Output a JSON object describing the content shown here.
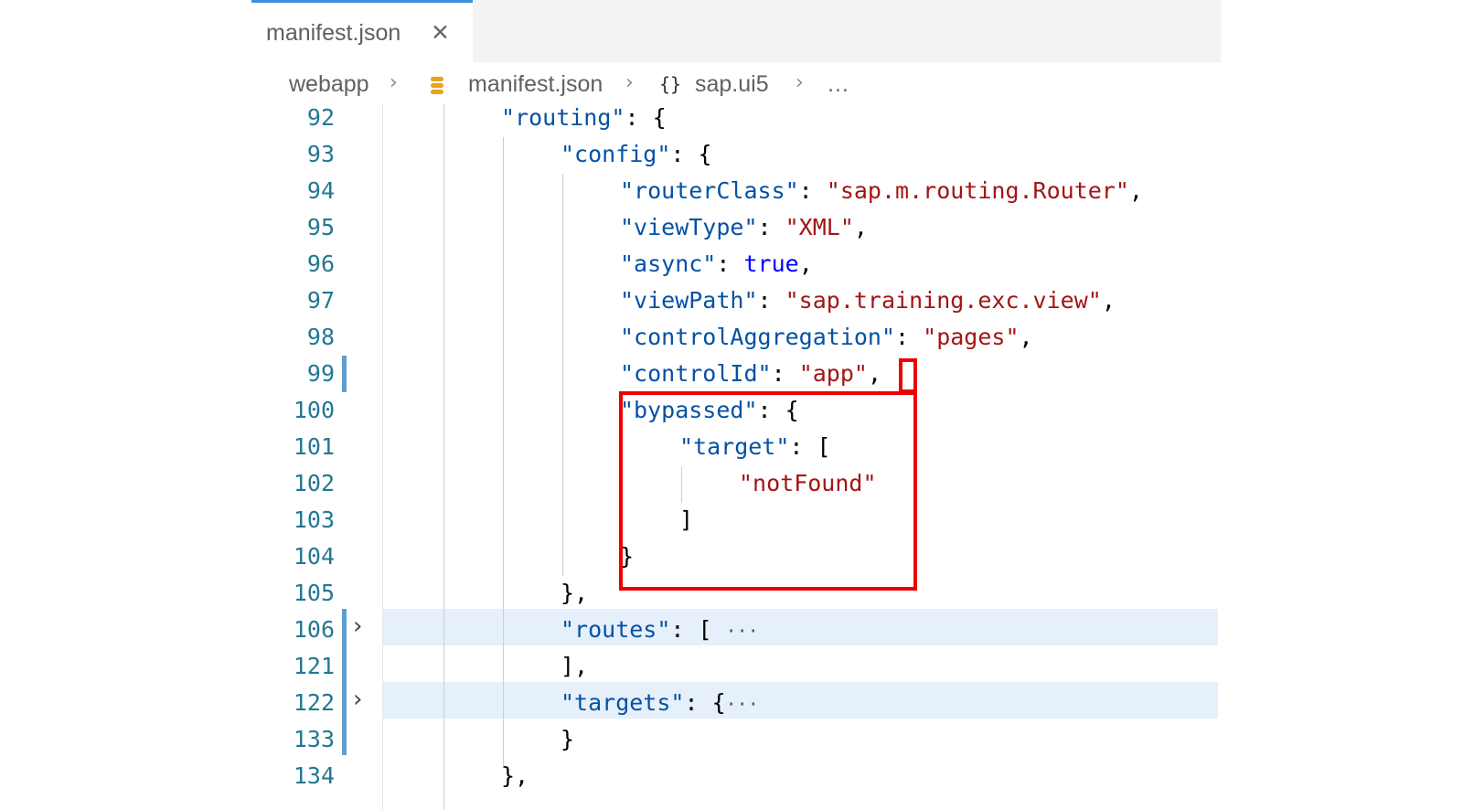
{
  "tab": {
    "title": "manifest.json",
    "close": "✕"
  },
  "breadcrumb": {
    "items": [
      "webapp",
      "manifest.json",
      "sap.ui5",
      "…"
    ],
    "separator": "›",
    "json_icon_label": "{}"
  },
  "colors": {
    "key": "#0451a5",
    "string": "#a31515",
    "boolean": "#0000ff",
    "line_number": "#237893",
    "highlight_box": "#ee0000",
    "folded_row_bg": "#e5f0fb",
    "modified_bar": "#5d9fd0"
  },
  "icons": {
    "file": "json-database-icon",
    "close": "close-icon",
    "fold": "chevron-right-icon",
    "symbol": "braces-icon"
  },
  "line_numbers": [
    "92",
    "93",
    "94",
    "95",
    "96",
    "97",
    "98",
    "99",
    "100",
    "101",
    "102",
    "103",
    "104",
    "105",
    "106",
    "121",
    "122",
    "133",
    "134"
  ],
  "code": {
    "l92": {
      "key": "\"routing\"",
      "rest": ": {"
    },
    "l93": {
      "key": "\"config\"",
      "rest": ": {"
    },
    "l94": {
      "key": "\"routerClass\"",
      "mid": ": ",
      "val": "\"sap.m.routing.Router\"",
      "end": ","
    },
    "l95": {
      "key": "\"viewType\"",
      "mid": ": ",
      "val": "\"XML\"",
      "end": ","
    },
    "l96": {
      "key": "\"async\"",
      "mid": ": ",
      "val": "true",
      "end": ","
    },
    "l97": {
      "key": "\"viewPath\"",
      "mid": ": ",
      "val": "\"sap.training.exc.view\"",
      "end": ","
    },
    "l98": {
      "key": "\"controlAggregation\"",
      "mid": ": ",
      "val": "\"pages\"",
      "end": ","
    },
    "l99": {
      "key": "\"controlId\"",
      "mid": ": ",
      "val": "\"app\"",
      "end": ","
    },
    "l100": {
      "key": "\"bypassed\"",
      "rest": ": {"
    },
    "l101": {
      "key": "\"target\"",
      "rest": ": ["
    },
    "l102": {
      "val": "\"notFound\""
    },
    "l103": {
      "text": "]"
    },
    "l104": {
      "text": "}"
    },
    "l105": {
      "text": "},"
    },
    "l106": {
      "key": "\"routes\"",
      "rest": ": [",
      "fold": "···"
    },
    "l121": {
      "text": "],"
    },
    "l122": {
      "key": "\"targets\"",
      "rest": ": {",
      "fold": "···"
    },
    "l133": {
      "text": "}"
    },
    "l134": {
      "text": "},"
    }
  }
}
